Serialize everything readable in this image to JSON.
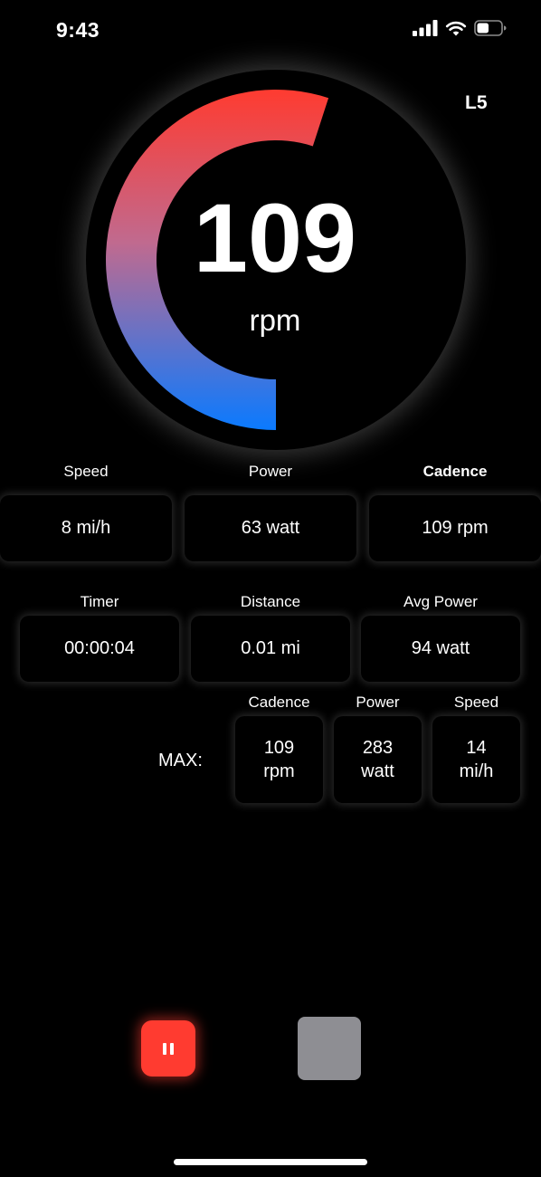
{
  "status_bar": {
    "time": "9:43",
    "icons": [
      "cellular-signal-icon",
      "wifi-icon",
      "battery-icon"
    ],
    "battery_level": 0.5
  },
  "level": "L5",
  "gauge": {
    "value": "109",
    "unit": "rpm",
    "arc_fill": 0.55,
    "gradient_colors": [
      "#ff3b30",
      "#0a7aff"
    ]
  },
  "row1": {
    "speed": {
      "label": "Speed",
      "value": "8 mi/h"
    },
    "power": {
      "label": "Power",
      "value": "63 watt"
    },
    "cadence": {
      "label": "Cadence",
      "value": "109 rpm"
    }
  },
  "row2": {
    "timer": {
      "label": "Timer",
      "value": "00:00:04"
    },
    "distance": {
      "label": "Distance",
      "value": "0.01 mi"
    },
    "avg_power": {
      "label": "Avg Power",
      "value": "94 watt"
    }
  },
  "max": {
    "label": "MAX:",
    "cadence": {
      "label": "Cadence",
      "value": "109",
      "unit": "rpm"
    },
    "power": {
      "label": "Power",
      "value": "283",
      "unit": "watt"
    },
    "speed": {
      "label": "Speed",
      "value": "14",
      "unit": "mi/h"
    }
  },
  "controls": {
    "pause_color": "#ff3b30",
    "stop_color": "#8e8e93"
  }
}
